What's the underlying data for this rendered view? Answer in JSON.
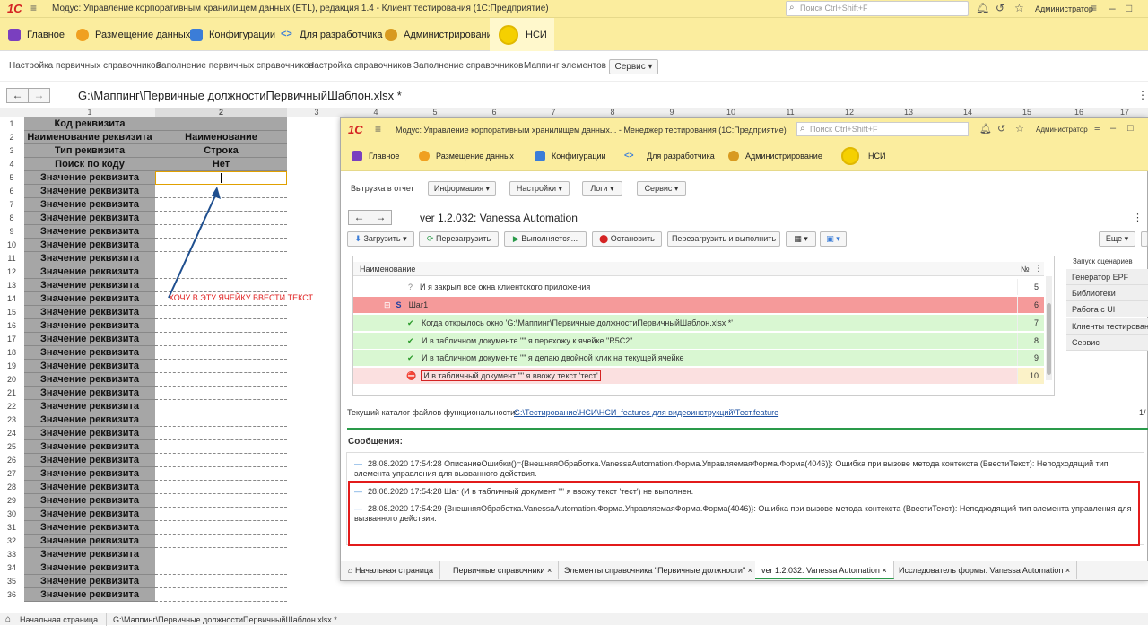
{
  "app": {
    "title": "Модус: Управление корпоративным хранилищем данных (ETL), редакция 1.4  - Клиент тестирования (1С:Предприятие)",
    "search_placeholder": "Поиск Ctrl+Shift+F",
    "user": "Администратор"
  },
  "sections": [
    "Главное",
    "Размещение данных",
    "Конфигурации",
    "Для разработчика",
    "Администрирование",
    "НСИ"
  ],
  "subnav": [
    "Настройка первичных справочников",
    "Заполнение первичных справочников",
    "Настройка справочников",
    "Заполнение справочников",
    "Маппинг элементов"
  ],
  "service": "Сервис",
  "doc_title": "G:\\Маппинг\\Первичные должностиПервичныйШаблон.xlsx *",
  "columns": [
    "1",
    "2",
    "3",
    "4",
    "5",
    "6",
    "7",
    "8",
    "9",
    "10",
    "11",
    "12",
    "13",
    "14",
    "15",
    "16",
    "17"
  ],
  "sheet": {
    "rows": [
      "1",
      "2",
      "3",
      "4",
      "5",
      "6",
      "7",
      "8",
      "9",
      "10",
      "11",
      "12",
      "13",
      "14",
      "15",
      "16",
      "17",
      "18",
      "19",
      "20",
      "21",
      "22",
      "23",
      "24",
      "25",
      "26",
      "27",
      "28",
      "29",
      "30",
      "31",
      "32",
      "33",
      "34",
      "35",
      "36"
    ],
    "colA": [
      "Код реквизита",
      "Наименование реквизита",
      "Тип реквизита",
      "Поиск по коду",
      "Значение реквизита"
    ],
    "colB": [
      "",
      "Наименование",
      "Строка",
      "Нет"
    ],
    "annotation": "ХОЧУ В ЭТУ ЯЧЕЙКУ ВВЕСТИ ТЕКСТ"
  },
  "bottom_tabs": [
    "Начальная страница",
    "G:\\Маппинг\\Первичные должностиПервичныйШаблон.xlsx *"
  ],
  "inner": {
    "title": "Модус: Управление корпоративным хранилищем данных...  - Менеджер тестирования (1С:Предприятие)",
    "search_placeholder": "Поиск Ctrl+Shift+F",
    "user": "Администратор",
    "sections": [
      "Главное",
      "Размещение данных",
      "Конфигурации",
      "Для разработчика",
      "Администрирование",
      "НСИ"
    ],
    "toolbar1": {
      "export": "Выгрузка в отчет",
      "info": "Информация",
      "settings": "Настройки",
      "logs": "Логи",
      "service": "Сервис"
    },
    "form_title": "ver 1.2.032: Vanessa Automation",
    "toolbar2": {
      "load": "Загрузить",
      "reload": "Перезагрузить",
      "running": "Выполняется...",
      "stop": "Остановить",
      "reload_run": "Перезагрузить и выполнить",
      "more": "Еще"
    },
    "tree": {
      "col_name": "Наименование",
      "col_num": "№",
      "rows": [
        {
          "text": "И я закрыл все окна клиентского приложения",
          "num": "5",
          "state": "q"
        },
        {
          "text": "Шаг1",
          "num": "6",
          "state": "step"
        },
        {
          "text": "Когда открылось окно 'G:\\Маппинг\\Первичные должностиПервичныйШаблон.xlsx *'",
          "num": "7",
          "state": "ok"
        },
        {
          "text": "И в табличном документе \"\" я перехожу к ячейке \"R5C2\"",
          "num": "8",
          "state": "ok"
        },
        {
          "text": "И в табличном документе \"\" я делаю двойной клик на текущей ячейке",
          "num": "9",
          "state": "ok"
        },
        {
          "text": "И в табличный документ \"\" я ввожу текст 'тест'",
          "num": "10",
          "state": "err"
        }
      ]
    },
    "right_tabs": [
      "Запуск сценариев",
      "Генератор EPF",
      "Библиотеки",
      "Работа с UI",
      "Клиенты тестирования",
      "Сервис"
    ],
    "catalog_label": "Текущий каталог файлов функциональности:",
    "catalog_path": "G:\\Тестирование\\НСИ\\НСИ_features для видеоинструкций\\Тест.feature",
    "catalog_page": "1/",
    "messages_title": "Сообщения:",
    "messages": [
      "28.08.2020 17:54:28 ОписаниеОшибки()={ВнешняяОбработка.VanessaAutomation.Форма.УправляемаяФорма.Форма(4046)}: Ошибка при вызове метода контекста (ВвестиТекст): Неподходящий тип элемента управления для вызванного действия.",
      "28.08.2020 17:54:28 Шаг (И в табличный документ \"\" я ввожу текст 'тест') не выполнен.",
      "28.08.2020 17:54:29 {ВнешняяОбработка.VanessaAutomation.Форма.УправляемаяФорма.Форма(4046)}: Ошибка при вызове метода контекста (ВвестиТекст): Неподходящий тип элемента управления для вызванного действия."
    ],
    "bottom_tabs": [
      "Начальная страница",
      "Первичные справочники",
      "Элементы справочника \"Первичные должности\"",
      "ver 1.2.032: Vanessa Automation",
      "Исследователь формы: Vanessa Automation"
    ]
  },
  "colors": {
    "title_bar": "#fbed9e",
    "header_gray": "#a6a6a6",
    "ok_row": "#d9f7d2",
    "step_row": "#f59a9a",
    "err_row": "#fbe0e0",
    "annotation": "#e02020",
    "arrow": "#1f4f8f",
    "highlight_box": "#e21b1b",
    "progress": "#2a9a4a"
  }
}
